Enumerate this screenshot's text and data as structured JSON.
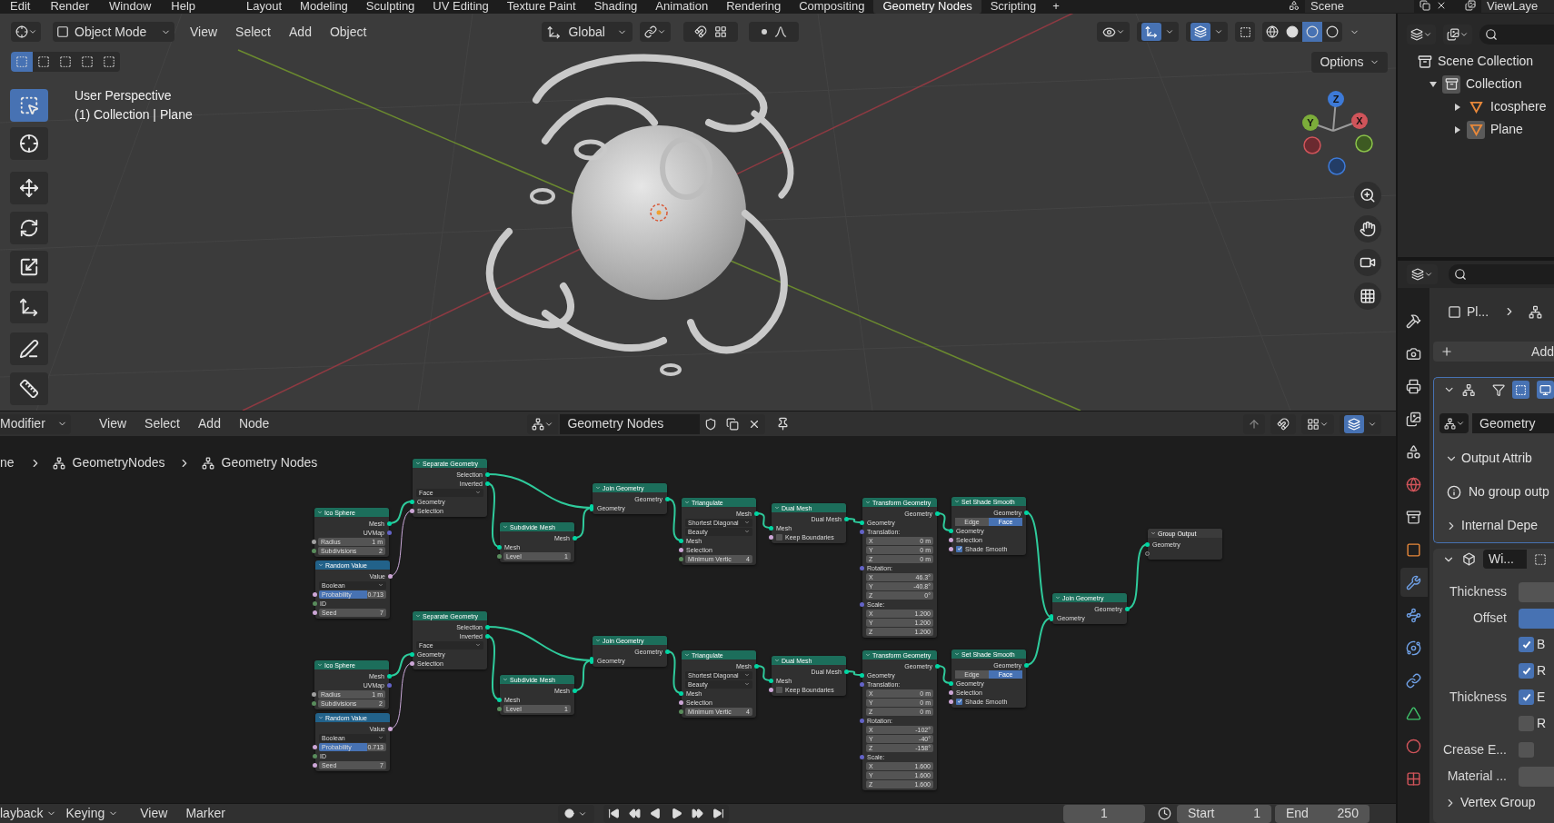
{
  "top_bar": {
    "menus": [
      "Edit",
      "Render",
      "Window",
      "Help"
    ],
    "workspaces": [
      {
        "label": "Layout",
        "selected": false
      },
      {
        "label": "Modeling",
        "selected": false
      },
      {
        "label": "Sculpting",
        "selected": false
      },
      {
        "label": "UV Editing",
        "selected": false
      },
      {
        "label": "Texture Paint",
        "selected": false
      },
      {
        "label": "Shading",
        "selected": false
      },
      {
        "label": "Animation",
        "selected": false
      },
      {
        "label": "Rendering",
        "selected": false
      },
      {
        "label": "Compositing",
        "selected": false
      },
      {
        "label": "Geometry Nodes",
        "selected": true
      },
      {
        "label": "Scripting",
        "selected": false
      }
    ],
    "add_tab": "+",
    "scene": "Scene",
    "view_layer": "ViewLaye"
  },
  "viewport": {
    "mode": "Object Mode",
    "menus": [
      "View",
      "Select",
      "Add",
      "Object"
    ],
    "orientation": "Global",
    "selection_modes": [
      {
        "selected": true
      },
      {
        "selected": false
      },
      {
        "selected": false
      },
      {
        "selected": false
      },
      {
        "selected": false
      }
    ],
    "shading": [
      {
        "kind": "wireframe",
        "selected": false
      },
      {
        "kind": "solid",
        "selected": false
      },
      {
        "kind": "material",
        "selected": true
      },
      {
        "kind": "rendered",
        "selected": false
      }
    ],
    "options": "Options",
    "info": [
      "User Perspective",
      "(1) Collection | Plane"
    ],
    "tools": [
      {
        "kind": "select",
        "selected": true
      },
      {
        "kind": "cursor",
        "selected": false
      },
      {
        "kind": "move",
        "selected": false
      },
      {
        "kind": "rotate",
        "selected": false
      },
      {
        "kind": "scale",
        "selected": false
      },
      {
        "kind": "transform",
        "selected": false
      },
      {
        "kind": "annotate",
        "selected": false
      },
      {
        "kind": "measure",
        "selected": false
      }
    ],
    "gizmo": {
      "z": "Z",
      "y": "Y",
      "x": "X"
    }
  },
  "node_editor": {
    "context": "Modifier",
    "menus": [
      "View",
      "Select",
      "Add",
      "Node"
    ],
    "tree_name": "Geometry Nodes",
    "breadcrumb": [
      "ne",
      "GeometryNodes",
      "Geometry Nodes"
    ],
    "nodes": [
      {
        "title": "Ico Sphere",
        "kind": "geometry",
        "rows": [
          {
            "kind": "output",
            "label": "Mesh",
            "color": "#00d6a3"
          },
          {
            "kind": "output",
            "label": "UVMap",
            "color": "#6363c7"
          },
          {
            "kind": "field",
            "label": "Radius",
            "value": "1 m",
            "color": "#a1a1a1"
          },
          {
            "kind": "field",
            "label": "Subdivisions",
            "value": "2",
            "color": "#598c5c"
          }
        ]
      },
      {
        "title": "Random Value",
        "kind": "function",
        "rows": [
          {
            "kind": "output",
            "label": "Value",
            "color": "#cca6d6"
          },
          {
            "kind": "dropdown",
            "value": "Boolean"
          },
          {
            "kind": "slider",
            "label": "Probability",
            "value": "0.713",
            "level": 0.713,
            "color": "#cca6d6"
          },
          {
            "kind": "input",
            "label": "ID",
            "color": "#598c5c"
          },
          {
            "kind": "field",
            "label": "Seed",
            "value": "7",
            "color": "#cca6d6"
          }
        ]
      },
      {
        "title": "Separate Geometry",
        "kind": "geometry",
        "rows": [
          {
            "kind": "output",
            "label": "Selection",
            "color": "#00d6a3"
          },
          {
            "kind": "output",
            "label": "Inverted",
            "color": "#00d6a3"
          },
          {
            "kind": "dropdown",
            "value": "Face"
          },
          {
            "kind": "input",
            "label": "Geometry",
            "color": "#00d6a3"
          },
          {
            "kind": "input",
            "label": "Selection",
            "color": "#cca6d6"
          }
        ]
      },
      {
        "title": "Subdivide Mesh",
        "kind": "geometry",
        "rows": [
          {
            "kind": "output",
            "label": "Mesh",
            "color": "#00d6a3"
          },
          {
            "kind": "input",
            "label": "Mesh",
            "color": "#00d6a3"
          },
          {
            "kind": "field",
            "label": "Level",
            "value": "1",
            "color": "#598c5c"
          }
        ]
      },
      {
        "title": "Join Geometry",
        "kind": "geometry",
        "rows": [
          {
            "kind": "output",
            "label": "Geometry",
            "color": "#00d6a3"
          },
          {
            "kind": "multi_input",
            "label": "Geometry",
            "color": "#00d6a3"
          }
        ]
      },
      {
        "title": "Triangulate",
        "kind": "geometry",
        "rows": [
          {
            "kind": "output",
            "label": "Mesh",
            "color": "#00d6a3"
          },
          {
            "kind": "dropdown",
            "value": "Shortest Diagonal"
          },
          {
            "kind": "dropdown",
            "value": "Beauty"
          },
          {
            "kind": "input",
            "label": "Mesh",
            "color": "#00d6a3"
          },
          {
            "kind": "input",
            "label": "Selection",
            "color": "#cca6d6"
          },
          {
            "kind": "field",
            "label": "Minimum Vertic",
            "value": "4",
            "color": "#598c5c"
          }
        ]
      },
      {
        "title": "Dual Mesh",
        "kind": "geometry",
        "rows": [
          {
            "kind": "output",
            "label": "Dual Mesh",
            "color": "#00d6a3"
          },
          {
            "kind": "input",
            "label": "Mesh",
            "color": "#00d6a3"
          },
          {
            "kind": "checkbox",
            "label": "Keep Boundaries",
            "checked": false,
            "color": "#cca6d6"
          }
        ]
      },
      {
        "title": "Transform Geometry",
        "kind": "geometry",
        "rows": [
          {
            "kind": "output",
            "label": "Geometry",
            "color": "#00d6a3"
          },
          {
            "kind": "input",
            "label": "Geometry",
            "color": "#00d6a3"
          },
          {
            "kind": "input",
            "label": "Translation:",
            "color": "#6363c7"
          },
          {
            "kind": "field",
            "label": "X",
            "value": "0 m"
          },
          {
            "kind": "field",
            "label": "Y",
            "value": "0 m"
          },
          {
            "kind": "field",
            "label": "Z",
            "value": "0 m"
          },
          {
            "kind": "input",
            "label": "Rotation:",
            "color": "#6363c7"
          },
          {
            "kind": "field",
            "label": "X",
            "value": "46.3°"
          },
          {
            "kind": "field",
            "label": "Y",
            "value": "-40.8°"
          },
          {
            "kind": "field",
            "label": "Z",
            "value": "0°"
          },
          {
            "kind": "input",
            "label": "Scale:",
            "color": "#6363c7"
          },
          {
            "kind": "field",
            "label": "X",
            "value": "1.200"
          },
          {
            "kind": "field",
            "label": "Y",
            "value": "1.200"
          },
          {
            "kind": "field",
            "label": "Z",
            "value": "1.200"
          }
        ]
      },
      {
        "title": "Set Shade Smooth",
        "kind": "geometry",
        "rows": [
          {
            "kind": "output",
            "label": "Geometry",
            "color": "#00d6a3"
          },
          {
            "kind": "toggle",
            "options": [
              {
                "label": "Edge",
                "selected": false
              },
              {
                "label": "Face",
                "selected": true
              }
            ]
          },
          {
            "kind": "input",
            "label": "Geometry",
            "color": "#00d6a3"
          },
          {
            "kind": "input",
            "label": "Selection",
            "color": "#cca6d6"
          },
          {
            "kind": "checkbox",
            "label": "Shade Smooth",
            "checked": true,
            "color": "#cca6d6"
          }
        ]
      },
      {
        "title": "Ico Sphere",
        "kind": "geometry",
        "rows": [
          {
            "kind": "output",
            "label": "Mesh",
            "color": "#00d6a3"
          },
          {
            "kind": "output",
            "label": "UVMap",
            "color": "#6363c7"
          },
          {
            "kind": "field",
            "label": "Radius",
            "value": "1 m",
            "color": "#a1a1a1"
          },
          {
            "kind": "field",
            "label": "Subdivisions",
            "value": "2",
            "color": "#598c5c"
          }
        ]
      },
      {
        "title": "Random Value",
        "kind": "function",
        "rows": [
          {
            "kind": "output",
            "label": "Value",
            "color": "#cca6d6"
          },
          {
            "kind": "dropdown",
            "value": "Boolean"
          },
          {
            "kind": "slider",
            "label": "Probability",
            "value": "0.713",
            "level": 0.713,
            "color": "#cca6d6"
          },
          {
            "kind": "input",
            "label": "ID",
            "color": "#598c5c"
          },
          {
            "kind": "field",
            "label": "Seed",
            "value": "7",
            "color": "#cca6d6"
          }
        ]
      },
      {
        "title": "Separate Geometry",
        "kind": "geometry",
        "rows": [
          {
            "kind": "output",
            "label": "Selection",
            "color": "#00d6a3"
          },
          {
            "kind": "output",
            "label": "Inverted",
            "color": "#00d6a3"
          },
          {
            "kind": "dropdown",
            "value": "Face"
          },
          {
            "kind": "input",
            "label": "Geometry",
            "color": "#00d6a3"
          },
          {
            "kind": "input",
            "label": "Selection",
            "color": "#cca6d6"
          }
        ]
      },
      {
        "title": "Subdivide Mesh",
        "kind": "geometry",
        "rows": [
          {
            "kind": "output",
            "label": "Mesh",
            "color": "#00d6a3"
          },
          {
            "kind": "input",
            "label": "Mesh",
            "color": "#00d6a3"
          },
          {
            "kind": "field",
            "label": "Level",
            "value": "1",
            "color": "#598c5c"
          }
        ]
      },
      {
        "title": "Join Geometry",
        "kind": "geometry",
        "rows": [
          {
            "kind": "output",
            "label": "Geometry",
            "color": "#00d6a3"
          },
          {
            "kind": "multi_input",
            "label": "Geometry",
            "color": "#00d6a3"
          }
        ]
      },
      {
        "title": "Triangulate",
        "kind": "geometry",
        "rows": [
          {
            "kind": "output",
            "label": "Mesh",
            "color": "#00d6a3"
          },
          {
            "kind": "dropdown",
            "value": "Shortest Diagonal"
          },
          {
            "kind": "dropdown",
            "value": "Beauty"
          },
          {
            "kind": "input",
            "label": "Mesh",
            "color": "#00d6a3"
          },
          {
            "kind": "input",
            "label": "Selection",
            "color": "#cca6d6"
          },
          {
            "kind": "field",
            "label": "Minimum Vertic",
            "value": "4",
            "color": "#598c5c"
          }
        ]
      },
      {
        "title": "Dual Mesh",
        "kind": "geometry",
        "rows": [
          {
            "kind": "output",
            "label": "Dual Mesh",
            "color": "#00d6a3"
          },
          {
            "kind": "input",
            "label": "Mesh",
            "color": "#00d6a3"
          },
          {
            "kind": "checkbox",
            "label": "Keep Boundaries",
            "checked": false,
            "color": "#cca6d6"
          }
        ]
      },
      {
        "title": "Transform Geometry",
        "kind": "geometry",
        "rows": [
          {
            "kind": "output",
            "label": "Geometry",
            "color": "#00d6a3"
          },
          {
            "kind": "input",
            "label": "Geometry",
            "color": "#00d6a3"
          },
          {
            "kind": "input",
            "label": "Translation:",
            "color": "#6363c7"
          },
          {
            "kind": "field",
            "label": "X",
            "value": "0 m"
          },
          {
            "kind": "field",
            "label": "Y",
            "value": "0 m"
          },
          {
            "kind": "field",
            "label": "Z",
            "value": "0 m"
          },
          {
            "kind": "input",
            "label": "Rotation:",
            "color": "#6363c7"
          },
          {
            "kind": "field",
            "label": "X",
            "value": "-102°"
          },
          {
            "kind": "field",
            "label": "Y",
            "value": "-40°"
          },
          {
            "kind": "field",
            "label": "Z",
            "value": "-158°"
          },
          {
            "kind": "input",
            "label": "Scale:",
            "color": "#6363c7"
          },
          {
            "kind": "field",
            "label": "X",
            "value": "1.600"
          },
          {
            "kind": "field",
            "label": "Y",
            "value": "1.600"
          },
          {
            "kind": "field",
            "label": "Z",
            "value": "1.600"
          }
        ]
      },
      {
        "title": "Set Shade Smooth",
        "kind": "geometry",
        "rows": [
          {
            "kind": "output",
            "label": "Geometry",
            "color": "#00d6a3"
          },
          {
            "kind": "toggle",
            "options": [
              {
                "label": "Edge",
                "selected": false
              },
              {
                "label": "Face",
                "selected": true
              }
            ]
          },
          {
            "kind": "input",
            "label": "Geometry",
            "color": "#00d6a3"
          },
          {
            "kind": "input",
            "label": "Selection",
            "color": "#cca6d6"
          },
          {
            "kind": "checkbox",
            "label": "Shade Smooth",
            "checked": true,
            "color": "#cca6d6"
          }
        ]
      },
      {
        "title": "Join Geometry",
        "kind": "geometry",
        "rows": [
          {
            "kind": "output",
            "label": "Geometry",
            "color": "#00d6a3"
          },
          {
            "kind": "multi_input",
            "label": "Geometry",
            "color": "#00d6a3"
          }
        ]
      },
      {
        "title": "Group Output",
        "kind": "output",
        "rows": [
          {
            "kind": "input",
            "label": "Geometry",
            "color": "#00d6a3"
          },
          {
            "kind": "empty"
          }
        ]
      }
    ]
  },
  "timeline": {
    "dropdowns": [
      "layback",
      "Keying"
    ],
    "menus": [
      "View",
      "Marker"
    ],
    "frame": "1",
    "start_label": "Start",
    "start": "1",
    "end_label": "End",
    "end": "250"
  },
  "outliner": {
    "tree": [
      {
        "label": "Scene Collection",
        "kind": "scene",
        "children": [
          {
            "label": "Collection",
            "kind": "collection",
            "expanded": true,
            "children": [
              {
                "label": "Icosphere",
                "kind": "mesh",
                "expanded": false,
                "selected": false
              },
              {
                "label": "Plane",
                "kind": "mesh",
                "expanded": false,
                "selected": true
              }
            ]
          }
        ]
      }
    ]
  },
  "properties": {
    "tabs": [
      {
        "kind": "tool",
        "selected": false
      },
      {
        "kind": "render",
        "selected": false
      },
      {
        "kind": "output",
        "selected": false
      },
      {
        "kind": "view_layer",
        "selected": false
      },
      {
        "kind": "scene",
        "selected": false
      },
      {
        "kind": "world",
        "selected": false
      },
      {
        "kind": "collection",
        "selected": false
      },
      {
        "kind": "object",
        "selected": false
      },
      {
        "kind": "modifier",
        "selected": true
      },
      {
        "kind": "particles",
        "selected": false
      },
      {
        "kind": "physics",
        "selected": false
      },
      {
        "kind": "constraints",
        "selected": false
      },
      {
        "kind": "data",
        "selected": false
      },
      {
        "kind": "material",
        "selected": false
      },
      {
        "kind": "texture",
        "selected": false
      }
    ],
    "breadcrumb": "Pl...",
    "add_button": "Add",
    "geometry_nodes": {
      "expanded": true,
      "node_group": "Geometry",
      "rows": [
        {
          "kind": "subpanel",
          "label": "Output Attrib",
          "expanded": true
        },
        {
          "kind": "info",
          "label": "No group outp"
        },
        {
          "kind": "subpanel",
          "label": "Internal Depe",
          "expanded": false
        }
      ]
    },
    "wireframe": {
      "expanded": true,
      "name": "Wi...",
      "rows": [
        {
          "kind": "field",
          "label": "Thickness",
          "highlighted": false
        },
        {
          "kind": "field",
          "label": "Offset",
          "highlighted": true
        },
        {
          "kind": "checkbox",
          "option": "B",
          "checked": true
        },
        {
          "kind": "checkbox",
          "option": "R",
          "checked": true
        },
        {
          "kind": "checkbox",
          "label": "Thickness",
          "option": "E",
          "checked": true
        },
        {
          "kind": "checkbox",
          "option": "R",
          "checked": false
        },
        {
          "kind": "checkbox",
          "label": "Crease E...",
          "checked": false
        },
        {
          "kind": "field",
          "label": "Material ...",
          "highlighted": false
        },
        {
          "kind": "subpanel",
          "label": "Vertex Group",
          "expanded": false
        }
      ]
    }
  }
}
